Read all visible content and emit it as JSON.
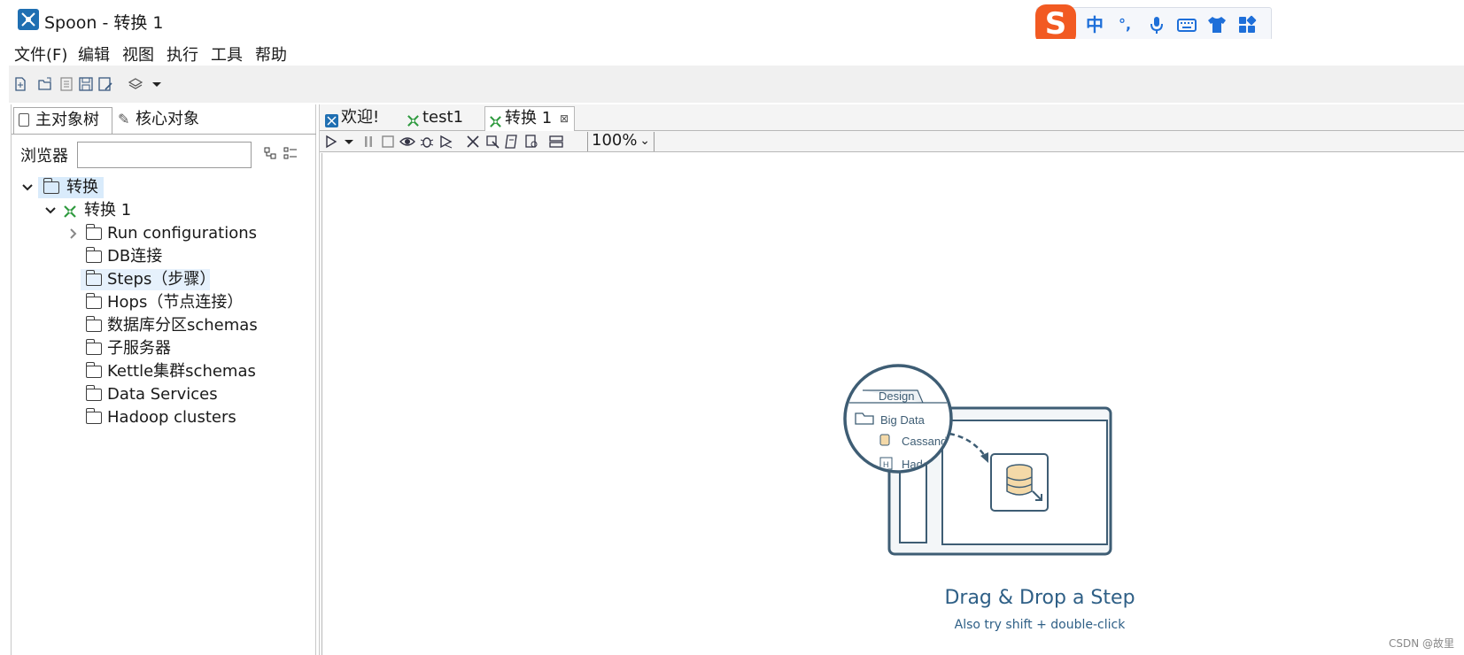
{
  "window": {
    "title": "Spoon - 转换 1"
  },
  "ime": {
    "logo": "S",
    "items": [
      "中",
      "°,",
      "mic-icon",
      "keyboard-icon",
      "shirt-icon",
      "grid-icon"
    ],
    "label_zh": "中",
    "label_punct": "°,"
  },
  "menu": {
    "items": [
      "文件(F)",
      "编辑",
      "视图",
      "执行",
      "工具",
      "帮助"
    ]
  },
  "left": {
    "tabs": [
      "主对象树",
      "核心对象"
    ],
    "browser_label": "浏览器",
    "browser_value": "",
    "tree": [
      {
        "label": "转换",
        "level": 0,
        "expanded": true
      },
      {
        "label": "转换 1",
        "level": 1,
        "expanded": true
      },
      {
        "label": "Run configurations",
        "level": 2,
        "expandable": true
      },
      {
        "label": "DB连接",
        "level": 2
      },
      {
        "label": "Steps（步骤）",
        "level": 2
      },
      {
        "label": "Hops（节点连接）",
        "level": 2
      },
      {
        "label": "数据库分区schemas",
        "level": 2
      },
      {
        "label": "子服务器",
        "level": 2
      },
      {
        "label": "Kettle集群schemas",
        "level": 2
      },
      {
        "label": "Data Services",
        "level": 2
      },
      {
        "label": "Hadoop clusters",
        "level": 2
      }
    ]
  },
  "editor": {
    "tabs": [
      "欢迎!",
      "test1",
      "转换 1"
    ],
    "zoom": "100%",
    "illustration": {
      "tab": "Design",
      "folder": "Big Data",
      "item1": "Cassandr",
      "item2": "Hadoop"
    },
    "drop_title": "Drag & Drop a Step",
    "drop_subtitle": "Also try shift + double-click"
  },
  "watermark": "CSDN @故里",
  "colors": {
    "accent": "#2e5f86",
    "selection": "#d9ebfb",
    "ime_logo": "#f25a22",
    "ime_icons": "#1e6fd9"
  }
}
